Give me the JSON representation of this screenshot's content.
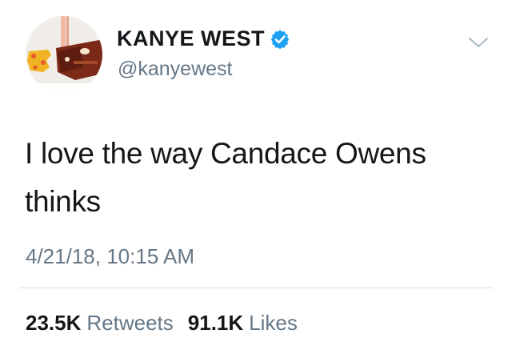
{
  "tweet": {
    "author": {
      "display_name": "KANYE WEST",
      "handle": "@kanyewest",
      "verified": true,
      "avatar": "kanye-west-avatar"
    },
    "text": "I love the way Candace Owens thinks",
    "timestamp": "4/21/18, 10:15 AM",
    "stats": {
      "retweets_count": "23.5K",
      "retweets_label": "Retweets",
      "likes_count": "91.1K",
      "likes_label": "Likes"
    }
  },
  "icons": {
    "verified": "verified-badge-icon",
    "menu": "chevron-down-icon"
  },
  "colors": {
    "verified_blue": "#1da1f2",
    "secondary_text": "#657786",
    "primary_text": "#14171a",
    "divider": "#d8dde1"
  }
}
